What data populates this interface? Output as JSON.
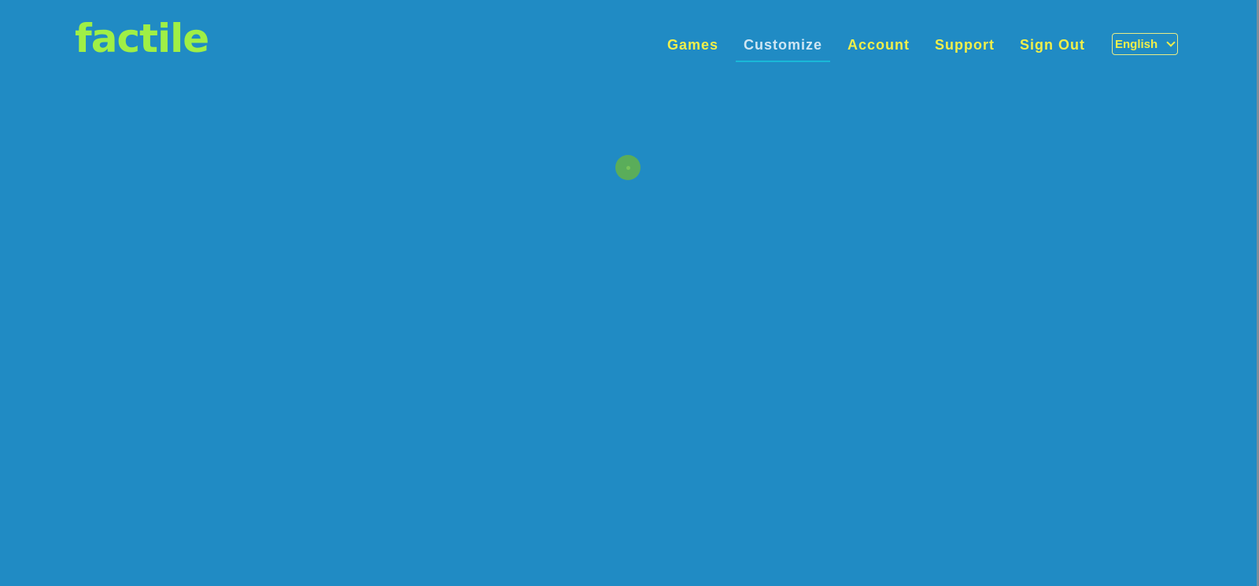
{
  "brand": {
    "logo_text": "factile"
  },
  "nav": {
    "items": [
      {
        "label": "Games",
        "active": false
      },
      {
        "label": "Customize",
        "active": true
      },
      {
        "label": "Account",
        "active": false
      },
      {
        "label": "Support",
        "active": false
      },
      {
        "label": "Sign Out",
        "active": false
      }
    ]
  },
  "language": {
    "selected": "English"
  },
  "loading": {
    "icon": "loading-spinner-icon"
  },
  "colors": {
    "background": "#208bc4",
    "logo": "#9fef46",
    "nav_text": "#f0ef4a",
    "nav_active_text": "#cfe6f3",
    "nav_active_underline": "#1ab8d8",
    "spinner": "#5aad5a"
  }
}
